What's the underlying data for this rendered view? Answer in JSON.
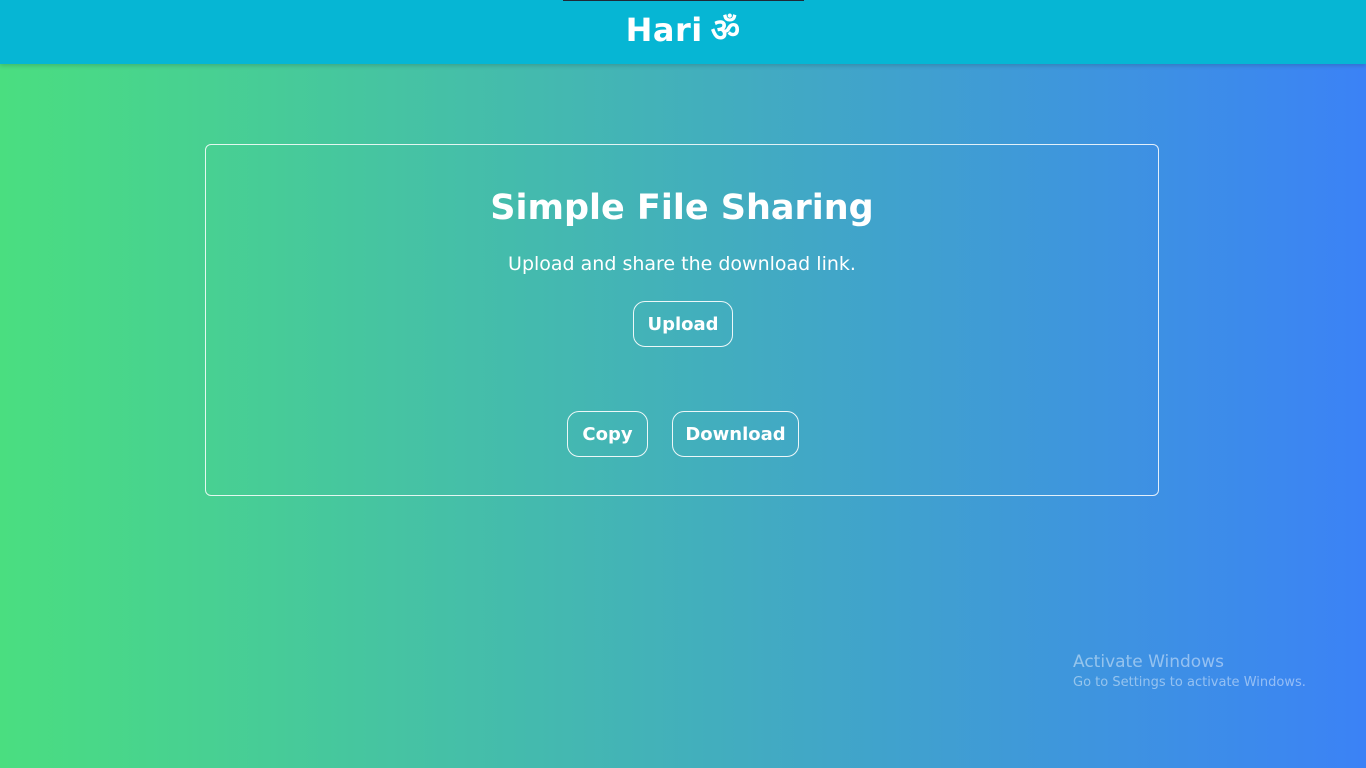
{
  "header": {
    "brand_text": "Hari",
    "brand_symbol": "ॐ",
    "background_color": "#06b6d4"
  },
  "page": {
    "gradient_start": "#4ade80",
    "gradient_end": "#3b82f6"
  },
  "card": {
    "title": "Simple File Sharing",
    "subtitle": "Upload and share the download link.",
    "upload_label": "Upload",
    "copy_label": "Copy",
    "download_label": "Download"
  },
  "watermark": {
    "title": "Activate Windows",
    "subtitle": "Go to Settings to activate Windows."
  }
}
